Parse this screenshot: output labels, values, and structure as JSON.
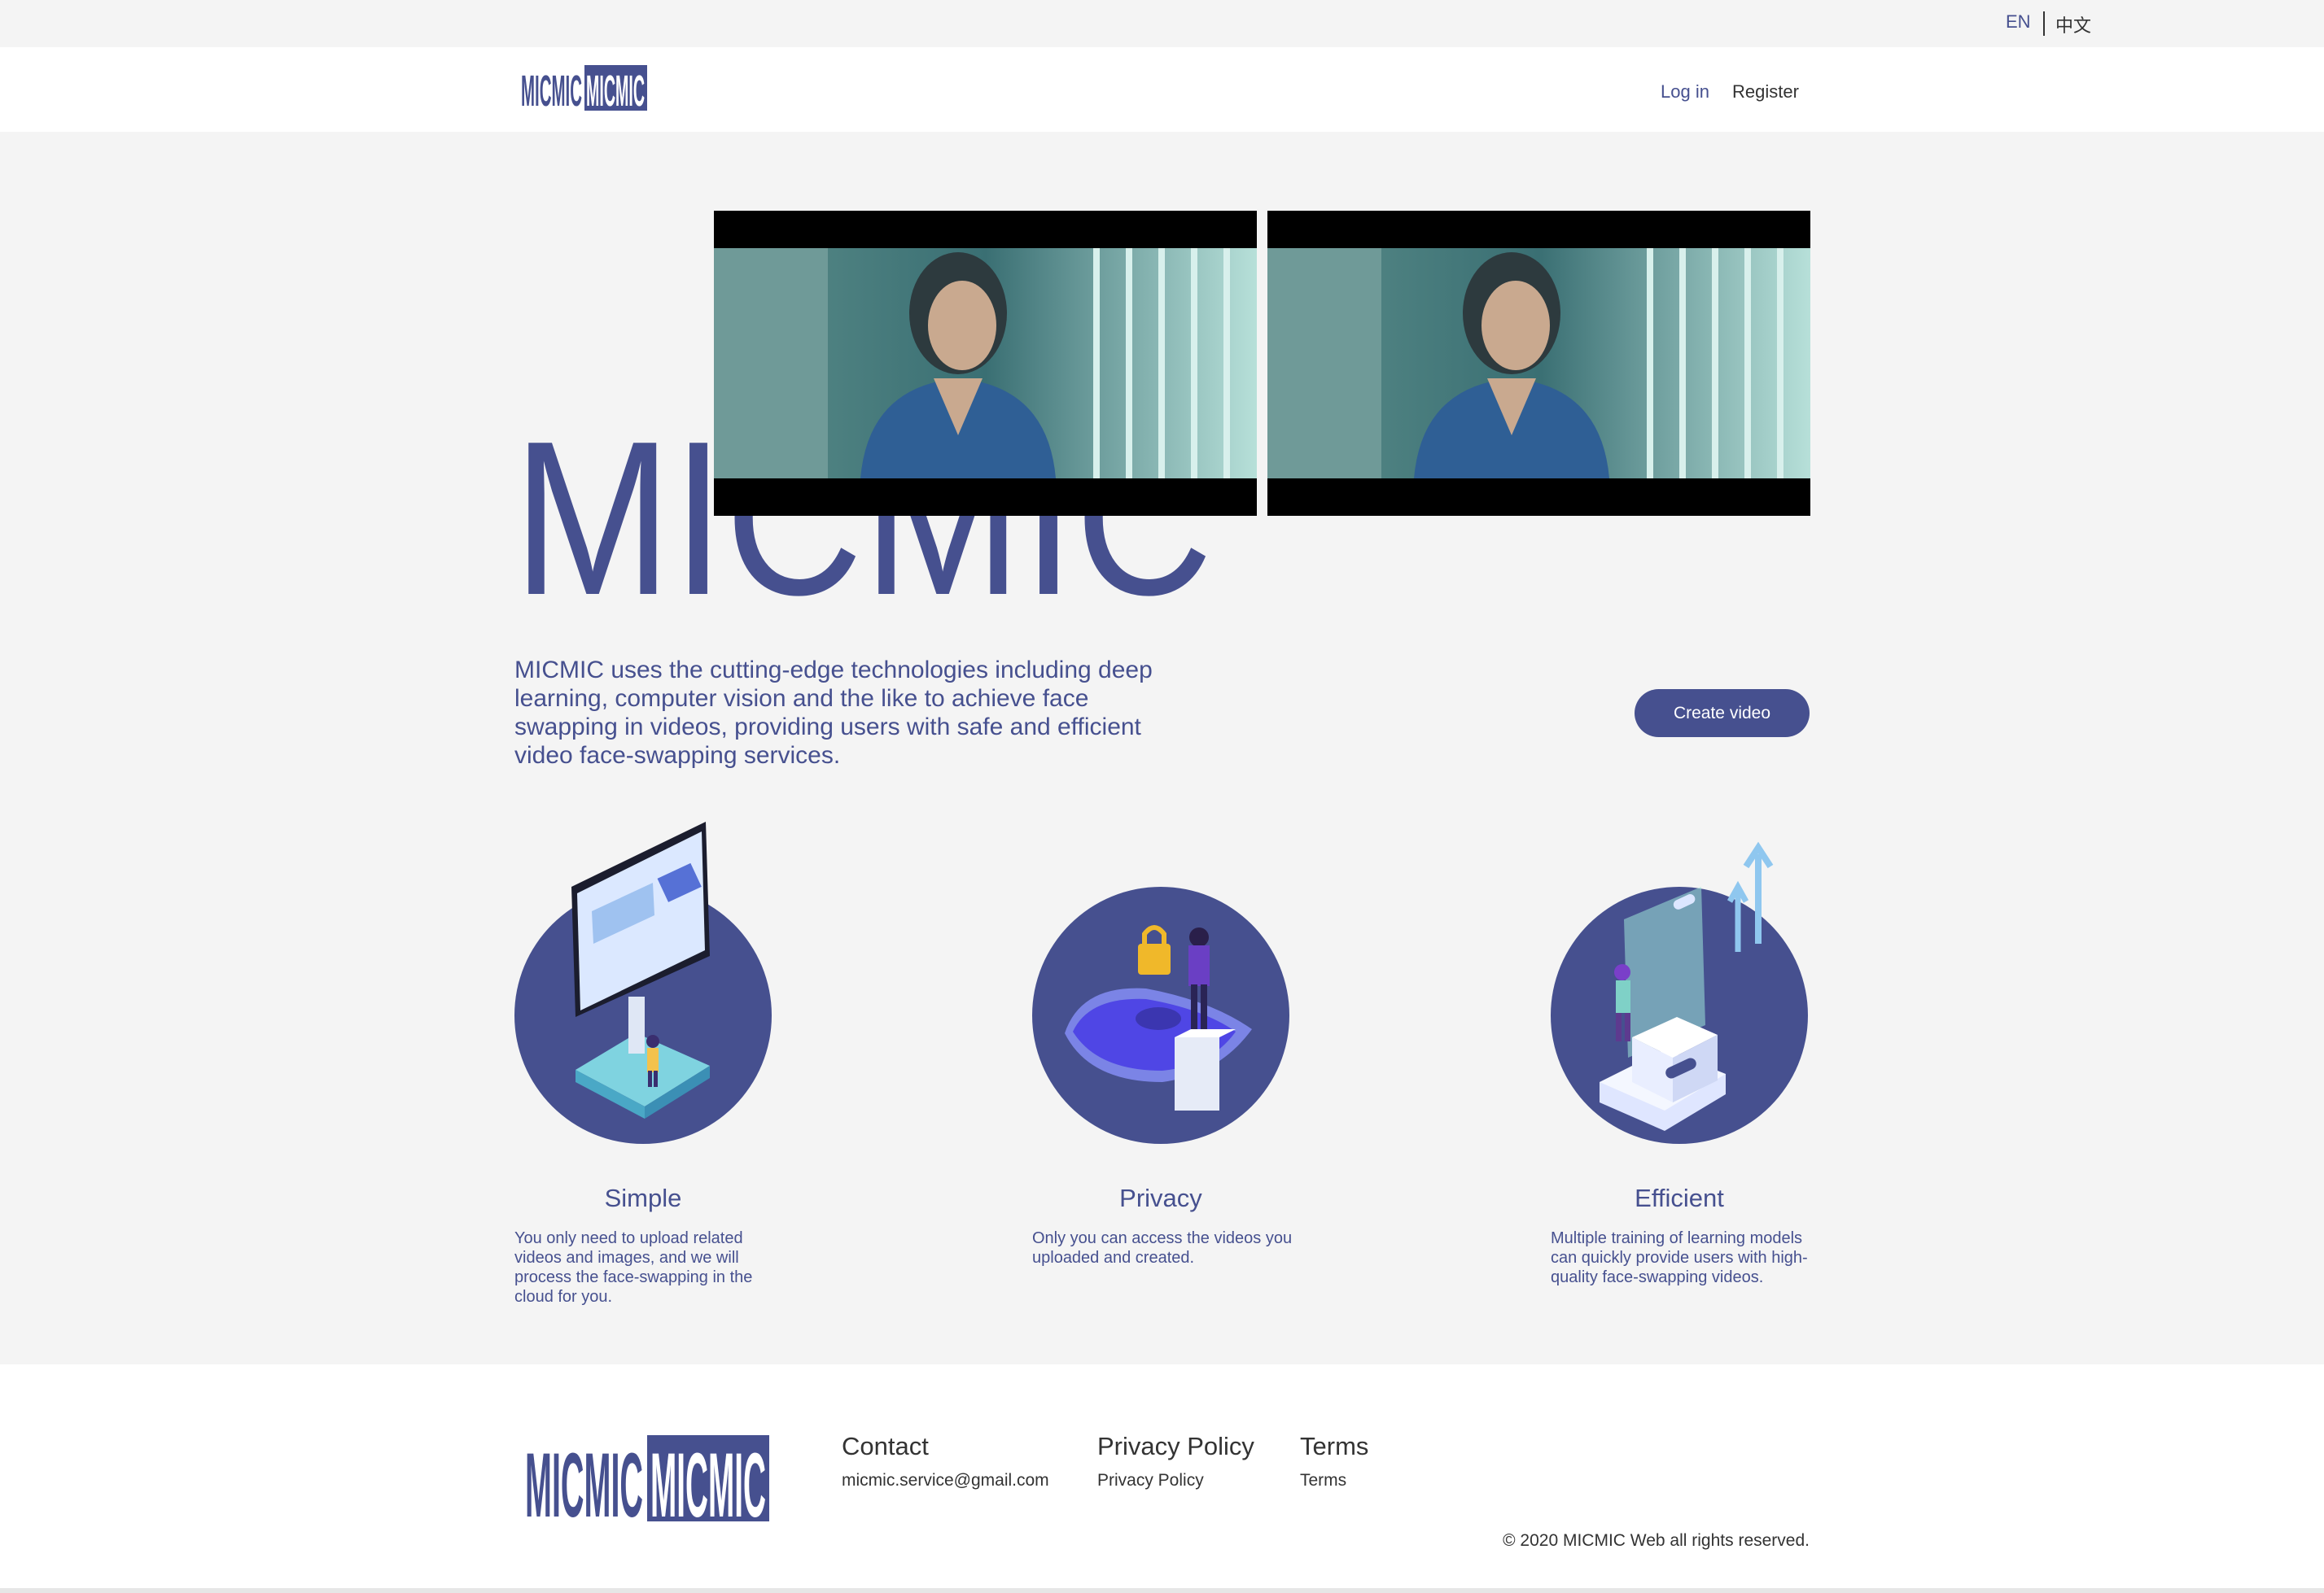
{
  "lang": {
    "en": "EN",
    "zh": "中文"
  },
  "header": {
    "logo": "MICMIC",
    "login": "Log in",
    "register": "Register"
  },
  "hero": {
    "title": "MICMIC",
    "intro": "MICMIC uses the cutting-edge technologies including deep learning, computer vision and the like to achieve face swapping in videos, providing users with safe and efficient video face-swapping services.",
    "cta": "Create video"
  },
  "features": [
    {
      "title": "Simple",
      "desc": "You only need to upload related videos and images, and we will process the face-swapping in the cloud for you."
    },
    {
      "title": "Privacy",
      "desc": "Only you can access the videos you uploaded and created."
    },
    {
      "title": "Efficient",
      "desc": "Multiple training of learning models can quickly provide users with high-quality face-swapping videos."
    }
  ],
  "footer": {
    "logo": "MICMIC",
    "contact_title": "Contact",
    "contact_email": "micmic.service@gmail.com",
    "privacy_title": "Privacy Policy",
    "privacy_link": "Privacy Policy",
    "terms_title": "Terms",
    "terms_link": "Terms",
    "copyright": "© 2020 MICMIC Web all rights reserved."
  },
  "colors": {
    "brand": "#46508f",
    "background": "#f4f4f4",
    "white": "#ffffff"
  }
}
